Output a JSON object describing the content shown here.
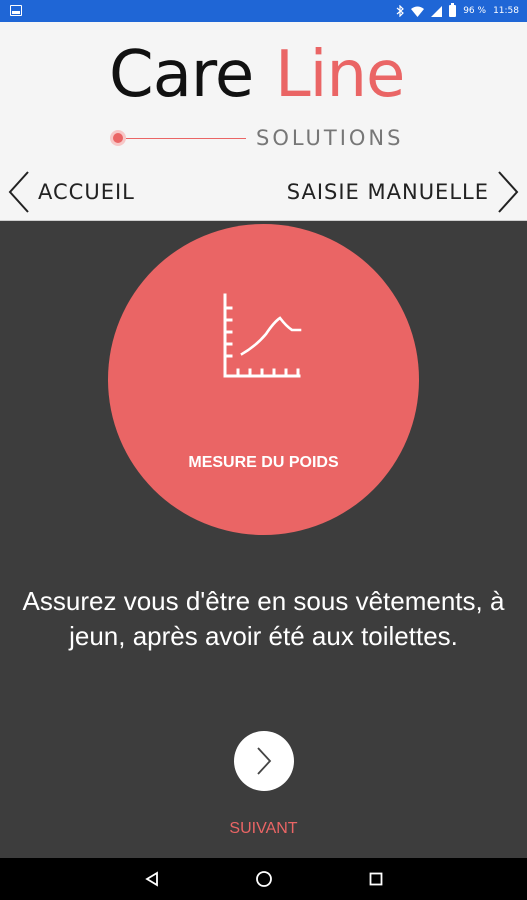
{
  "status_bar": {
    "battery_percent": "96 %",
    "time": "11:58"
  },
  "logo": {
    "part1": "Care",
    "part2": "Line",
    "subtitle": "SOLUTIONS"
  },
  "nav": {
    "prev_label": "ACCUEIL",
    "next_label": "SAISIE MANUELLE"
  },
  "card": {
    "title": "MESURE DU POIDS"
  },
  "instruction": "Assurez vous d'être en sous vêtements, à jeun, après avoir été aux toilettes.",
  "next_button_label": "SUIVANT",
  "colors": {
    "accent": "#ea6565",
    "background": "#3d3d3d",
    "header": "#f5f5f5",
    "status_bar": "#1f66d6"
  }
}
